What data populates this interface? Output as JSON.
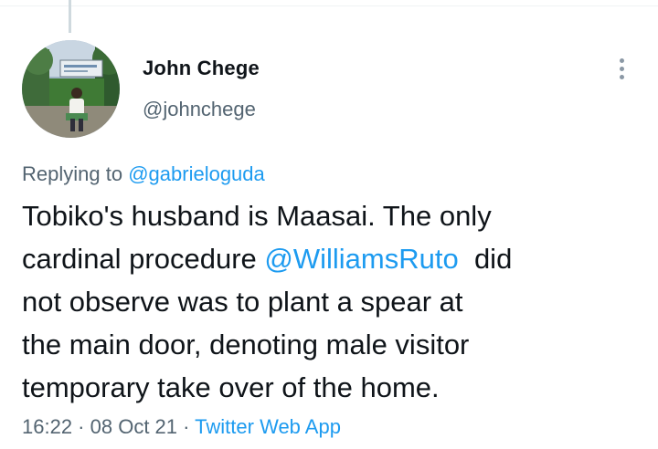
{
  "author": {
    "name": "John Chege",
    "handle": "@johnchege"
  },
  "reply": {
    "prefix": "Replying to",
    "to": "@gabrieloguda"
  },
  "tweet": {
    "line1": "Tobiko's husband is Maasai. The only",
    "line2_before": "cardinal procedure ",
    "mention": "@WilliamsRuto",
    "line2_after": "  did",
    "line3": "not observe was to plant a spear at",
    "line4": "the main door, denoting male visitor",
    "line5": "temporary take over of the home."
  },
  "meta": {
    "time": "16:22",
    "separator": " · ",
    "date": "08 Oct 21",
    "source": "Twitter Web App"
  },
  "colors": {
    "link": "#1d9bf0",
    "secondary_text": "#536471",
    "primary_text": "#0f1419"
  },
  "icons": {
    "more": "vertical-ellipsis-icon"
  }
}
